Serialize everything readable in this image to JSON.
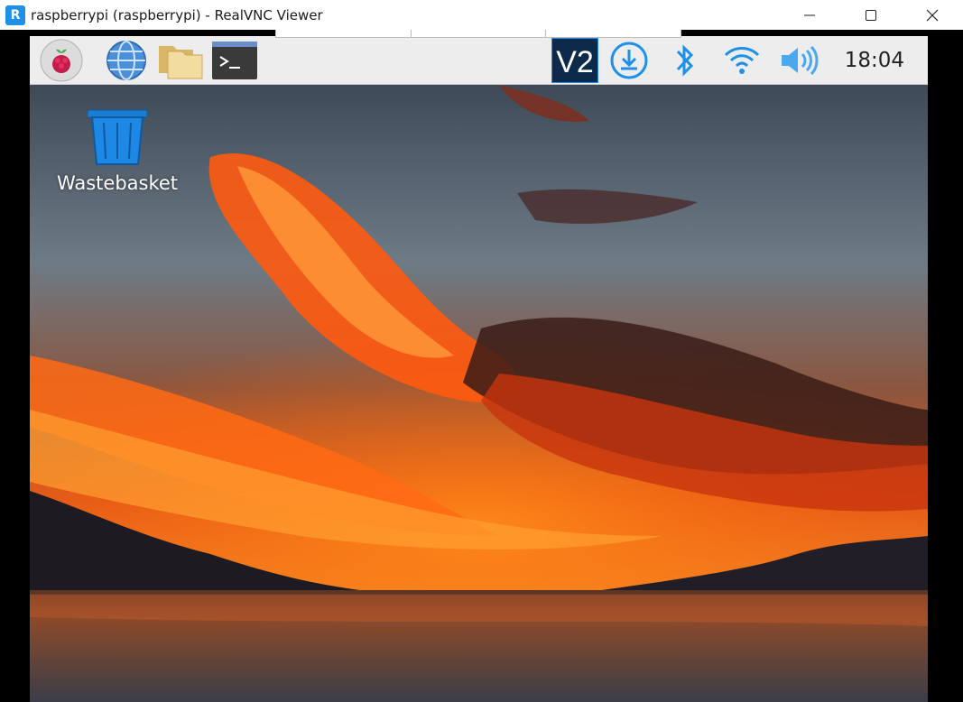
{
  "window": {
    "title": "raspberrypi (raspberrypi) - RealVNC Viewer",
    "app_icon": "realvnc-icon",
    "controls": [
      "minimize",
      "maximize",
      "close"
    ]
  },
  "taskbar": {
    "launchers": [
      {
        "name": "raspberry-menu-icon"
      },
      {
        "name": "web-browser-icon"
      },
      {
        "name": "file-manager-icon"
      },
      {
        "name": "terminal-icon"
      }
    ],
    "tray": [
      {
        "name": "vnc-server-icon"
      },
      {
        "name": "updates-download-icon"
      },
      {
        "name": "bluetooth-icon"
      },
      {
        "name": "wifi-icon"
      },
      {
        "name": "volume-icon"
      }
    ],
    "clock": "18:04"
  },
  "desktop": {
    "icons": [
      {
        "label": "Wastebasket",
        "icon": "wastebasket-icon"
      }
    ]
  },
  "colors": {
    "tray_accent": "#1e90e8",
    "sunset_orange": "#ff6a00"
  }
}
